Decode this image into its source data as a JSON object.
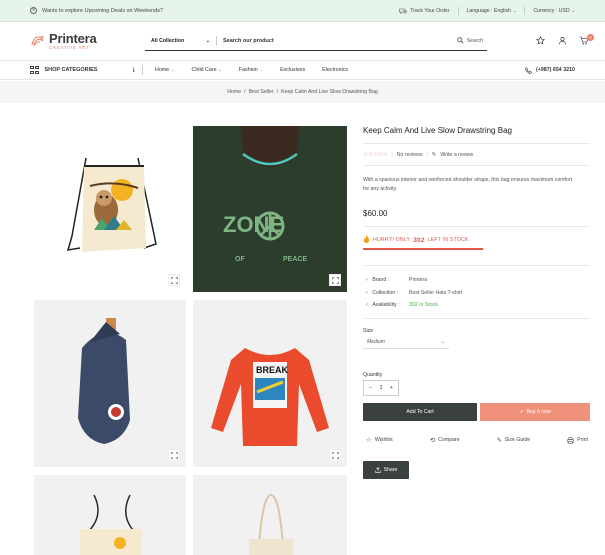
{
  "topbar": {
    "promo": "Wants to explore Upcoming Deals on Weekends?",
    "track": "Track Your Order",
    "language": "Language : English",
    "currency": "Currency : USD"
  },
  "brand": {
    "name": "Printera",
    "tagline": "CREATIVE ART"
  },
  "search": {
    "category": "All Collection",
    "placeholder": "Search our product",
    "button": "Search"
  },
  "cart": {
    "count": "0"
  },
  "nav": {
    "shop_categories": "SHOP CATEGORIES",
    "items": [
      "Home",
      "Child Care",
      "Fashion",
      "Exclusives",
      "Electronics"
    ],
    "phone": "(+987) 654 3210"
  },
  "breadcrumb": {
    "home": "Home",
    "section": "Best Seller",
    "current": "Keep Calm And Live Slow Drawstring Bag"
  },
  "product": {
    "title": "Keep Calm And Live Slow Drawstring Bag",
    "rating": 0,
    "stars": "☆☆☆☆☆",
    "reviews": "No reviews",
    "write_review": "Write a review",
    "description": "With a spacious interior and reinforced shoulder straps, this bag ensures maximum comfort for any activity.",
    "price": "$60.00",
    "hurry_prefix": "HURRY! ONLY",
    "hurry_count": "302",
    "hurry_suffix": "LEFT IN STOCK.",
    "brand_label": "Brand :",
    "brand_value": "Printera",
    "collection_label": "Collection :",
    "collection_value": "Best Seller Hats T-shirt",
    "availability_label": "Availability :",
    "availability_value": "302 In Stock",
    "size_label": "Size",
    "size_value": "Medium",
    "quantity_label": "Quantity",
    "quantity_value": "1",
    "add_to_cart": "Add To Cart",
    "buy_now": "Buy it now",
    "wishlist": "Wishlist",
    "compare": "Compare",
    "size_guide": "Size Guide",
    "print": "Print",
    "share": "Share"
  },
  "images": {
    "t2_text_top": "ZONE",
    "t2_text_left": "OF",
    "t2_text_right": "PEACE",
    "t4_text": "BREAK"
  },
  "colors": {
    "accent": "#e97e63",
    "dark_button": "#3b4040",
    "buy_button": "#f0917b",
    "stock_red": "#e25548",
    "in_stock_green": "#4caf50"
  }
}
